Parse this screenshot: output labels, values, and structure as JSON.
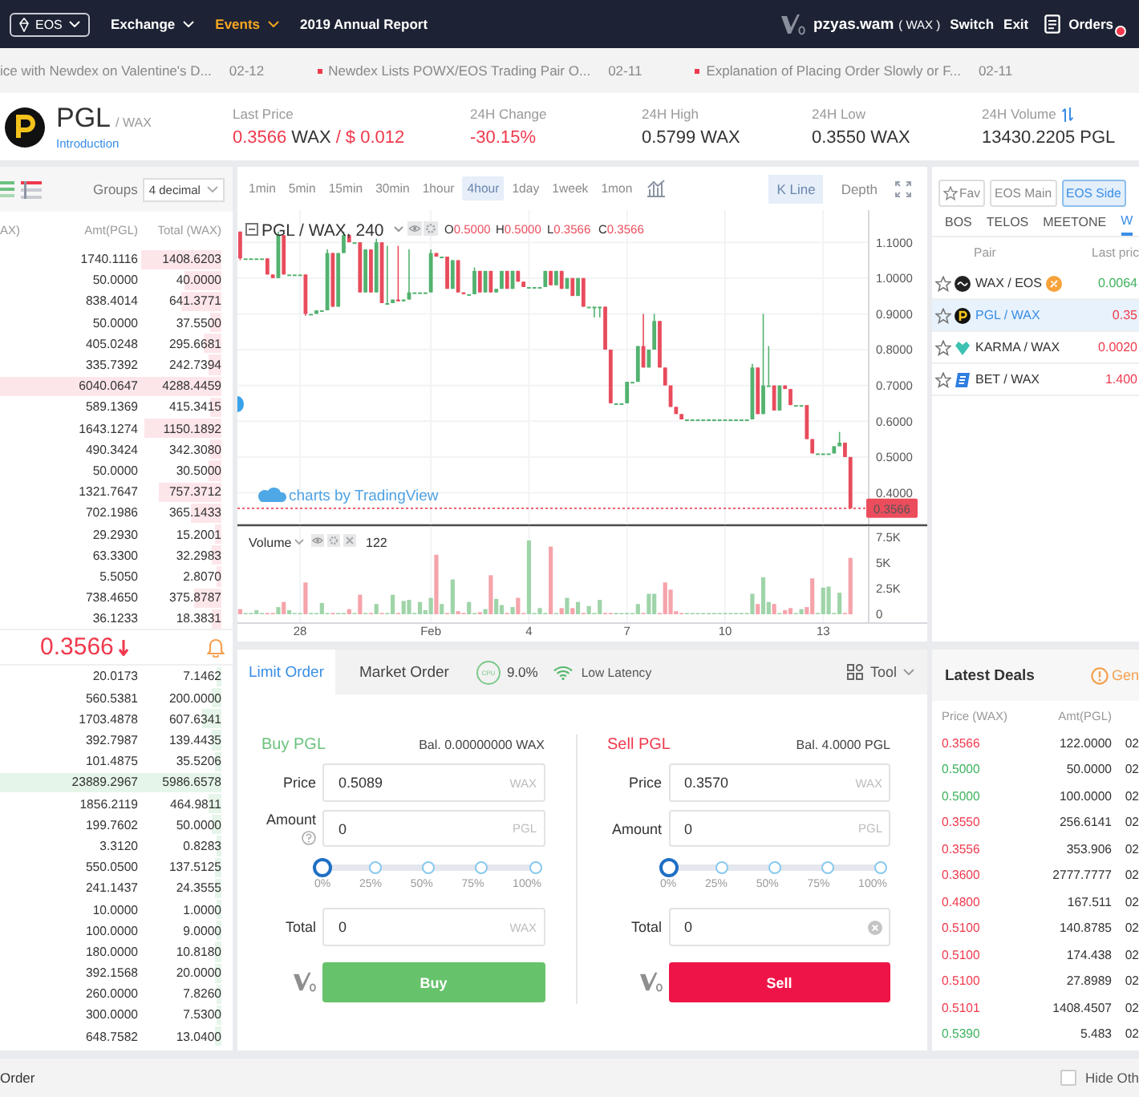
{
  "header": {
    "exchange_selector": {
      "label": "EOS"
    },
    "nav": [
      {
        "label": "Exchange",
        "dropdown": true,
        "highlighted": false
      },
      {
        "label": "Events",
        "dropdown": true,
        "highlighted": true
      },
      {
        "label": "2019 Annual Report",
        "dropdown": false,
        "highlighted": false
      }
    ],
    "account": {
      "name": "pzyas.wam",
      "chain": "( WAX )"
    },
    "links": [
      "Switch",
      "Exit"
    ],
    "orders": {
      "label": "Orders",
      "unread": true
    }
  },
  "news_ticker": [
    {
      "title": "ice with Newdex on Valentine's D...",
      "date": "02-12",
      "marker": false
    },
    {
      "title": "Newdex Lists POWX/EOS Trading Pair O...",
      "date": "02-11",
      "marker": true
    },
    {
      "title": "Explanation of Placing Order Slowly or F...",
      "date": "02-11",
      "marker": true
    }
  ],
  "market": {
    "symbol": "PGL",
    "quote": "/ WAX",
    "link": "Introduction",
    "stats": [
      {
        "label": "Last Price",
        "value": "0.3566",
        "unit": "WAX",
        "extra": "/ $ 0.012",
        "falling": true,
        "switch": false
      },
      {
        "label": "24H Change",
        "value": "-30.15%",
        "falling": true,
        "switch": false
      },
      {
        "label": "24H High",
        "value": "0.5799",
        "unit": "WAX",
        "falling": false,
        "switch": false
      },
      {
        "label": "24H Low",
        "value": "0.3550",
        "unit": "WAX",
        "falling": false,
        "switch": false
      },
      {
        "label": "24H Volume",
        "value": "13430.2205",
        "unit": "PGL",
        "falling": false,
        "switch": true
      }
    ]
  },
  "order_book": {
    "groups": {
      "label": "Groups",
      "value": "4 decimal"
    },
    "columns": [
      "AX)",
      "Amt(PGL)",
      "Total (WAX)"
    ],
    "asks": [
      {
        "amount": "1740.1116",
        "total": "1408.6203",
        "level": 0.36
      },
      {
        "amount": "50.0000",
        "total": "40.0000",
        "level": 0.17
      },
      {
        "amount": "838.4014",
        "total": "641.3771",
        "level": 0.18
      },
      {
        "amount": "50.0000",
        "total": "37.5500",
        "level": 0.05
      },
      {
        "amount": "405.0248",
        "total": "295.6681",
        "level": 0.08
      },
      {
        "amount": "335.7392",
        "total": "242.7394",
        "level": 0.06
      },
      {
        "amount": "6040.0647",
        "total": "4288.4459",
        "level": 1
      },
      {
        "amount": "589.1369",
        "total": "415.3415",
        "level": 0.05
      },
      {
        "amount": "1643.1274",
        "total": "1150.1892",
        "level": 0.35
      },
      {
        "amount": "490.3424",
        "total": "342.3080",
        "level": 0.05
      },
      {
        "amount": "50.0000",
        "total": "30.5000",
        "level": 0.06
      },
      {
        "amount": "1321.7647",
        "total": "757.3712",
        "level": 0.28
      },
      {
        "amount": "702.1986",
        "total": "365.1433",
        "level": 0.14
      },
      {
        "amount": "29.2930",
        "total": "15.2001",
        "level": 0.03
      },
      {
        "amount": "63.3300",
        "total": "32.2983",
        "level": 0.04
      },
      {
        "amount": "5.5050",
        "total": "2.8070",
        "level": 0.02
      },
      {
        "amount": "738.4650",
        "total": "375.8787",
        "level": 0.12
      },
      {
        "amount": "36.1233",
        "total": "18.3831",
        "level": 0.04
      }
    ],
    "last_price": {
      "value": "0.3566",
      "falling": true
    },
    "bids": [
      {
        "amount": "20.0173",
        "total": "7.1462",
        "level": 0.02
      },
      {
        "amount": "560.5381",
        "total": "200.0000",
        "level": 0.04
      },
      {
        "amount": "1703.4878",
        "total": "607.6341",
        "level": 0.09
      },
      {
        "amount": "392.7987",
        "total": "139.4435",
        "level": 0.04
      },
      {
        "amount": "101.4875",
        "total": "35.5206",
        "level": 0.03
      },
      {
        "amount": "23889.2967",
        "total": "5986.6578",
        "level": 1
      },
      {
        "amount": "1856.2119",
        "total": "464.9811",
        "level": 0.06
      },
      {
        "amount": "199.7602",
        "total": "50.0000",
        "level": 0.04
      },
      {
        "amount": "3.3120",
        "total": "0.8283",
        "level": 0.02
      },
      {
        "amount": "550.0500",
        "total": "137.5125",
        "level": 0.03
      },
      {
        "amount": "241.1437",
        "total": "24.3555",
        "level": 0.03
      },
      {
        "amount": "10.0000",
        "total": "1.0000",
        "level": 0.02
      },
      {
        "amount": "100.0000",
        "total": "9.0000",
        "level": 0.02
      },
      {
        "amount": "180.0000",
        "total": "10.8180",
        "level": 0.03
      },
      {
        "amount": "392.1568",
        "total": "20.0000",
        "level": 0.03
      },
      {
        "amount": "260.0000",
        "total": "7.8260",
        "level": 0.02
      },
      {
        "amount": "300.0000",
        "total": "7.5300",
        "level": 0.02
      },
      {
        "amount": "648.7582",
        "total": "13.0400",
        "level": 0.03
      }
    ]
  },
  "chart": {
    "intervals": [
      {
        "label": "1min",
        "selected": false
      },
      {
        "label": "5min",
        "selected": false
      },
      {
        "label": "15min",
        "selected": false
      },
      {
        "label": "30min",
        "selected": false
      },
      {
        "label": "1hour",
        "selected": false
      },
      {
        "label": "4hour",
        "selected": true
      },
      {
        "label": "1day",
        "selected": false
      },
      {
        "label": "1week",
        "selected": false
      },
      {
        "label": "1mon",
        "selected": false
      }
    ],
    "views": [
      {
        "label": "K Line",
        "selected": true
      },
      {
        "label": "Depth",
        "selected": false
      }
    ],
    "legend": {
      "symbol": "PGL / WAX, 240",
      "ohlc": [
        {
          "key": "O",
          "value": "0.5000"
        },
        {
          "key": "H",
          "value": "0.5000"
        },
        {
          "key": "L",
          "value": "0.3566"
        },
        {
          "key": "C",
          "value": "0.3566"
        }
      ]
    },
    "chart_data": {
      "type": "candlestick",
      "categories": [
        null,
        null,
        null,
        null,
        null,
        null,
        null,
        null,
        null,
        null,
        null,
        null,
        null,
        null,
        null,
        null,
        null,
        null,
        null,
        null,
        null,
        null,
        null,
        null,
        null,
        null,
        null,
        null,
        null,
        null,
        null,
        null,
        null,
        null,
        null,
        null,
        null,
        null,
        null,
        null,
        null,
        null,
        null,
        null,
        null,
        null,
        null,
        null,
        null,
        null,
        null,
        null,
        null,
        null,
        null,
        null,
        null,
        null,
        null,
        null,
        null,
        null,
        null,
        null,
        null,
        null,
        null,
        null,
        null,
        null,
        null,
        null,
        null,
        null,
        null,
        null,
        null,
        null,
        null,
        null,
        null,
        null,
        null,
        null,
        null,
        null,
        null,
        null,
        null,
        null,
        null,
        null,
        null,
        null,
        null,
        null,
        null,
        null,
        null,
        null,
        null,
        null,
        null,
        null,
        null,
        null,
        null,
        null,
        null,
        null,
        null,
        null,
        null,
        null,
        null,
        null
      ],
      "ohlc": [
        [
          1.13,
          1.13,
          1.05,
          1.055
        ],
        [
          1.055,
          1.055,
          1.055,
          1.055
        ],
        [
          1.055,
          1.055,
          1.055,
          1.055
        ],
        [
          1.055,
          1.055,
          1.055,
          1.055
        ],
        [
          1.055,
          1.055,
          1.055,
          1.055
        ],
        [
          1.055,
          1.055,
          1.01,
          1.01
        ],
        [
          1.01,
          1.01,
          1.0,
          1.0
        ],
        [
          1.0,
          1.13,
          1.0,
          1.12
        ],
        [
          1.12,
          1.12,
          1.01,
          1.01
        ],
        [
          1.01,
          1.01,
          1.01,
          1.01
        ],
        [
          1.01,
          1.01,
          1.01,
          1.01
        ],
        [
          1.01,
          1.01,
          1.01,
          1.01
        ],
        [
          1.01,
          1.01,
          0.895,
          0.9
        ],
        [
          0.9,
          0.9,
          0.9,
          0.9
        ],
        [
          0.9,
          0.91,
          0.9,
          0.91
        ],
        [
          0.91,
          0.91,
          0.91,
          0.91
        ],
        [
          0.91,
          1.08,
          0.91,
          1.07
        ],
        [
          1.07,
          1.07,
          0.92,
          0.92
        ],
        [
          0.92,
          1.07,
          0.92,
          1.07
        ],
        [
          1.07,
          1.13,
          1.07,
          1.12
        ],
        [
          1.12,
          1.12,
          1.1,
          1.1
        ],
        [
          1.1,
          1.1,
          1.1,
          1.1
        ],
        [
          1.1,
          1.1,
          0.96,
          0.96
        ],
        [
          0.96,
          1.08,
          0.96,
          1.08
        ],
        [
          1.08,
          1.08,
          0.96,
          0.96
        ],
        [
          0.96,
          1.11,
          0.96,
          1.1
        ],
        [
          1.1,
          1.1,
          0.93,
          0.93
        ],
        [
          0.93,
          1.09,
          0.93,
          0.93
        ],
        [
          0.93,
          0.94,
          0.93,
          0.94
        ],
        [
          0.94,
          1.09,
          0.935,
          0.935
        ],
        [
          0.935,
          0.94,
          0.935,
          0.94
        ],
        [
          0.94,
          1.08,
          0.94,
          0.96
        ],
        [
          0.96,
          0.96,
          0.96,
          0.96
        ],
        [
          0.96,
          0.96,
          0.96,
          0.96
        ],
        [
          0.96,
          0.96,
          0.96,
          0.96
        ],
        [
          0.96,
          1.08,
          0.96,
          1.07
        ],
        [
          1.07,
          1.07,
          1.06,
          1.06
        ],
        [
          1.06,
          1.06,
          1.06,
          1.06
        ],
        [
          1.06,
          1.06,
          0.97,
          0.97
        ],
        [
          0.97,
          1.05,
          0.97,
          1.05
        ],
        [
          1.05,
          1.05,
          0.96,
          0.96
        ],
        [
          0.96,
          0.96,
          0.955,
          0.955
        ],
        [
          0.955,
          0.955,
          0.955,
          0.955
        ],
        [
          0.955,
          1.03,
          0.955,
          1.02
        ],
        [
          1.02,
          1.02,
          0.96,
          0.96
        ],
        [
          0.96,
          1.02,
          0.96,
          1.02
        ],
        [
          1.02,
          1.02,
          0.96,
          0.96
        ],
        [
          0.96,
          0.97,
          0.96,
          0.97
        ],
        [
          0.97,
          1.02,
          0.97,
          1.02
        ],
        [
          1.02,
          1.02,
          0.97,
          0.97
        ],
        [
          0.97,
          1.02,
          0.97,
          1.02
        ],
        [
          1.02,
          1.02,
          0.99,
          0.99
        ],
        [
          0.99,
          0.99,
          0.975,
          0.975
        ],
        [
          0.975,
          0.975,
          0.975,
          0.975
        ],
        [
          0.975,
          0.975,
          0.975,
          0.975
        ],
        [
          0.975,
          0.975,
          0.975,
          0.975
        ],
        [
          0.975,
          1.02,
          0.975,
          1.02
        ],
        [
          1.02,
          1.02,
          0.98,
          0.98
        ],
        [
          0.98,
          1.02,
          0.98,
          1.02
        ],
        [
          1.02,
          1.02,
          0.97,
          0.97
        ],
        [
          0.97,
          1.0,
          0.97,
          1.0
        ],
        [
          1.0,
          1.0,
          0.95,
          0.95
        ],
        [
          0.95,
          1.0,
          0.95,
          1.0
        ],
        [
          1.0,
          1.0,
          0.92,
          0.92
        ],
        [
          0.92,
          0.92,
          0.92,
          0.92
        ],
        [
          0.92,
          0.92,
          0.89,
          0.92
        ],
        [
          0.92,
          0.92,
          0.89,
          0.92
        ],
        [
          0.92,
          0.92,
          0.8,
          0.8
        ],
        [
          0.8,
          0.8,
          0.65,
          0.65
        ],
        [
          0.65,
          0.65,
          0.65,
          0.65
        ],
        [
          0.65,
          0.65,
          0.65,
          0.65
        ],
        [
          0.65,
          0.71,
          0.65,
          0.71
        ],
        [
          0.71,
          0.71,
          0.71,
          0.71
        ],
        [
          0.71,
          0.81,
          0.71,
          0.81
        ],
        [
          0.81,
          0.9,
          0.75,
          0.75
        ],
        [
          0.75,
          0.8,
          0.75,
          0.8
        ],
        [
          0.8,
          0.9,
          0.8,
          0.88
        ],
        [
          0.88,
          0.88,
          0.75,
          0.75
        ],
        [
          0.75,
          0.75,
          0.7,
          0.7
        ],
        [
          0.7,
          0.7,
          0.64,
          0.64
        ],
        [
          0.64,
          0.64,
          0.62,
          0.62
        ],
        [
          0.62,
          0.62,
          0.605,
          0.605
        ],
        [
          0.605,
          0.605,
          0.605,
          0.605
        ],
        [
          0.605,
          0.605,
          0.605,
          0.605
        ],
        [
          0.605,
          0.605,
          0.605,
          0.605
        ],
        [
          0.605,
          0.605,
          0.605,
          0.605
        ],
        [
          0.605,
          0.605,
          0.605,
          0.605
        ],
        [
          0.605,
          0.605,
          0.605,
          0.605
        ],
        [
          0.605,
          0.605,
          0.605,
          0.605
        ],
        [
          0.605,
          0.605,
          0.605,
          0.605
        ],
        [
          0.605,
          0.605,
          0.605,
          0.605
        ],
        [
          0.605,
          0.605,
          0.605,
          0.605
        ],
        [
          0.605,
          0.605,
          0.605,
          0.605
        ],
        [
          0.605,
          0.605,
          0.605,
          0.605
        ],
        [
          0.605,
          0.76,
          0.605,
          0.75
        ],
        [
          0.75,
          0.75,
          0.62,
          0.62
        ],
        [
          0.62,
          0.9,
          0.62,
          0.7
        ],
        [
          0.7,
          0.81,
          0.7,
          0.7
        ],
        [
          0.7,
          0.7,
          0.63,
          0.63
        ],
        [
          0.63,
          0.7,
          0.63,
          0.7
        ],
        [
          0.7,
          0.7,
          0.69,
          0.69
        ],
        [
          0.69,
          0.69,
          0.645,
          0.645
        ],
        [
          0.645,
          0.645,
          0.645,
          0.645
        ],
        [
          0.645,
          0.645,
          0.645,
          0.645
        ],
        [
          0.645,
          0.645,
          0.55,
          0.55
        ],
        [
          0.55,
          0.55,
          0.51,
          0.51
        ],
        [
          0.51,
          0.51,
          0.51,
          0.51
        ],
        [
          0.51,
          0.51,
          0.51,
          0.51
        ],
        [
          0.51,
          0.51,
          0.51,
          0.51
        ],
        [
          0.51,
          0.53,
          0.51,
          0.53
        ],
        [
          0.53,
          0.57,
          0.53,
          0.54
        ],
        [
          0.54,
          0.54,
          0.5,
          0.5
        ],
        [
          0.5,
          0.5,
          0.3566,
          0.3566
        ],
        null,
        null,
        null
      ],
      "ylim": [
        0.307,
        1.19
      ],
      "yticks": [
        {
          "value": 1.1,
          "label": "1.1000"
        },
        {
          "value": 1.0,
          "label": "1.0000"
        },
        {
          "value": 0.9,
          "label": "0.9000"
        },
        {
          "value": 0.8,
          "label": "0.8000"
        },
        {
          "value": 0.7,
          "label": "0.7000"
        },
        {
          "value": 0.6,
          "label": "0.6000"
        },
        {
          "value": 0.5,
          "label": "0.5000"
        },
        {
          "value": 0.4,
          "label": "0.4000"
        }
      ],
      "grid": true,
      "ref_lines": [
        {
          "axis": "y",
          "value": 0.3566,
          "label": "0.3566"
        }
      ]
    },
    "credit": "charts by TradingView",
    "volume": {
      "label": "Volume",
      "value": "122",
      "chart_data": {
        "type": "bar",
        "categories": [
          null,
          null,
          null,
          null,
          null,
          null,
          null,
          null,
          null,
          null,
          null,
          "28",
          null,
          null,
          null,
          null,
          null,
          null,
          null,
          null,
          null,
          null,
          null,
          null,
          null,
          null,
          null,
          null,
          null,
          null,
          null,
          null,
          null,
          null,
          null,
          "Feb",
          null,
          null,
          null,
          null,
          null,
          null,
          null,
          null,
          null,
          null,
          null,
          null,
          null,
          null,
          null,
          null,
          null,
          "4",
          null,
          null,
          null,
          null,
          null,
          null,
          null,
          null,
          null,
          null,
          null,
          null,
          null,
          null,
          null,
          null,
          null,
          "7",
          null,
          null,
          null,
          null,
          null,
          null,
          null,
          null,
          null,
          null,
          null,
          null,
          null,
          null,
          null,
          null,
          null,
          "10",
          null,
          null,
          null,
          null,
          null,
          null,
          null,
          null,
          null,
          null,
          null,
          null,
          null,
          null,
          null,
          null,
          null,
          "13",
          null,
          null,
          null,
          null,
          null,
          null,
          null,
          null
        ],
        "values": [
          500,
          0,
          0,
          400,
          0,
          0,
          0,
          700,
          1200,
          400,
          0,
          0,
          3100,
          0,
          0,
          1100,
          0,
          0,
          0,
          0,
          500,
          0,
          1900,
          0,
          0,
          1000,
          0,
          0,
          1900,
          0,
          1300,
          1400,
          0,
          1200,
          400,
          1600,
          5800,
          1000,
          0,
          3400,
          300,
          0,
          1200,
          0,
          200,
          500,
          3800,
          1500,
          900,
          0,
          700,
          1600,
          0,
          7200,
          0,
          600,
          0,
          6600,
          0,
          600,
          1600,
          600,
          1200,
          0,
          800,
          0,
          1400,
          0,
          0,
          0,
          0,
          0,
          0,
          1000,
          0,
          2000,
          2000,
          0,
          3100,
          2400,
          300,
          0,
          0,
          0,
          0,
          0,
          0,
          0,
          0,
          0,
          0,
          0,
          0,
          0,
          2000,
          1000,
          3600,
          1200,
          1000,
          0,
          400,
          600,
          0,
          500,
          700,
          3500,
          0,
          2600,
          2700,
          0,
          2100,
          0,
          5500,
          null,
          null,
          null
        ],
        "ylim": [
          0,
          8600
        ],
        "yticks": [
          {
            "value": 7500,
            "label": "7.5K"
          },
          {
            "value": 5000,
            "label": "5K"
          },
          {
            "value": 2500,
            "label": "2.5K"
          },
          0
        ],
        "grid": true
      }
    }
  },
  "markets": {
    "groups": [
      {
        "label": "Fav",
        "kind": "favorites",
        "selected": false
      },
      {
        "label": "EOS Main",
        "kind": "plain",
        "selected": false
      },
      {
        "label": "EOS Side",
        "kind": "plain",
        "selected": true
      }
    ],
    "chains": [
      {
        "label": "BOS",
        "selected": false
      },
      {
        "label": "TELOS",
        "selected": false
      },
      {
        "label": "MEETONE",
        "selected": false
      },
      {
        "label": "W",
        "selected": true
      }
    ],
    "columns": [
      "Pair",
      "Last pric"
    ],
    "pairs": [
      {
        "name": "WAX / EOS",
        "price": "0.0064",
        "rising": true,
        "selected": false,
        "favorite": false,
        "badge": true
      },
      {
        "name": "PGL / WAX",
        "price": "0.35",
        "rising": false,
        "selected": true,
        "favorite": false,
        "badge": false
      },
      {
        "name": "KARMA / WAX",
        "price": "0.0020",
        "rising": false,
        "selected": false,
        "favorite": false,
        "badge": false
      },
      {
        "name": "BET / WAX",
        "price": "1.400",
        "rising": false,
        "selected": false,
        "favorite": false,
        "badge": false
      }
    ]
  },
  "latest_deals": {
    "title": "Latest Deals",
    "notice": "Gen",
    "columns": [
      "Price (WAX)",
      "Amt(PGL)"
    ],
    "rows": [
      {
        "price": "0.3566",
        "amount": "122.0000",
        "time": "02",
        "buy": false
      },
      {
        "price": "0.5000",
        "amount": "50.0000",
        "time": "02",
        "buy": true
      },
      {
        "price": "0.5000",
        "amount": "100.0000",
        "time": "02",
        "buy": true
      },
      {
        "price": "0.3550",
        "amount": "256.6141",
        "time": "02",
        "buy": false
      },
      {
        "price": "0.3556",
        "amount": "353.906",
        "time": "02",
        "buy": false
      },
      {
        "price": "0.3600",
        "amount": "2777.7777",
        "time": "02",
        "buy": false
      },
      {
        "price": "0.4800",
        "amount": "167.511",
        "time": "02",
        "buy": false
      },
      {
        "price": "0.5100",
        "amount": "140.8785",
        "time": "02",
        "buy": false
      },
      {
        "price": "0.5100",
        "amount": "174.438",
        "time": "02",
        "buy": false
      },
      {
        "price": "0.5100",
        "amount": "27.8989",
        "time": "02",
        "buy": false
      },
      {
        "price": "0.5101",
        "amount": "1408.4507",
        "time": "02",
        "buy": false
      },
      {
        "price": "0.5390",
        "amount": "5.483",
        "time": "02",
        "buy": true
      }
    ]
  },
  "order_form": {
    "tabs": [
      {
        "label": "Limit Order",
        "selected": true
      },
      {
        "label": "Market Order",
        "selected": false
      }
    ],
    "cpu": {
      "badge": "CPU",
      "value": "9.0%"
    },
    "network": "Low Latency",
    "tool": "Tool",
    "buy": {
      "title": "Buy PGL",
      "balance": "Bal. 0.00000000 WAX",
      "price": {
        "label": "Price",
        "value": "0.5089",
        "unit": "WAX"
      },
      "amount": {
        "label": "Amount",
        "value": "0",
        "unit": "PGL",
        "help": true
      },
      "slider": {
        "level": 0,
        "marks": [
          "0%",
          "25%",
          "50%",
          "75%",
          "100%"
        ]
      },
      "total": {
        "label": "Total",
        "value": "0",
        "unit": "WAX",
        "clearable": false
      },
      "button": "Buy"
    },
    "sell": {
      "title": "Sell PGL",
      "balance": "Bal. 4.0000 PGL",
      "price": {
        "label": "Price",
        "value": "0.3570",
        "unit": "WAX"
      },
      "amount": {
        "label": "Amount",
        "value": "0",
        "unit": "PGL",
        "help": false
      },
      "slider": {
        "level": 0,
        "marks": [
          "0%",
          "25%",
          "50%",
          "75%",
          "100%"
        ]
      },
      "total": {
        "label": "Total",
        "value": "0",
        "clearable": true
      },
      "button": "Sell"
    }
  },
  "bottom_bar": {
    "title": "Order",
    "hide_others": {
      "label": "Hide Oth",
      "checked": false
    }
  }
}
